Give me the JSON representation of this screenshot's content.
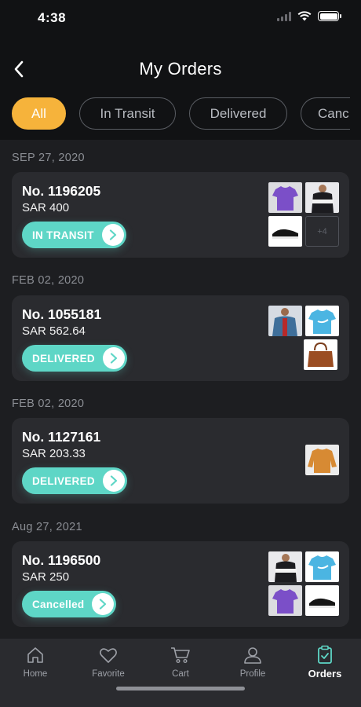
{
  "status_bar": {
    "time": "4:38"
  },
  "header": {
    "title": "My Orders"
  },
  "filters": [
    {
      "label": "All",
      "active": true
    },
    {
      "label": "In Transit",
      "active": false
    },
    {
      "label": "Delivered",
      "active": false
    },
    {
      "label": "Canc",
      "active": false
    }
  ],
  "orders": [
    {
      "date": "SEP 27, 2020",
      "number": "No. 1196205",
      "price": "SAR 400",
      "status": "IN TRANSIT",
      "more": "+4"
    },
    {
      "date": "FEB 02, 2020",
      "number": "No. 1055181",
      "price": "SAR 562.64",
      "status": "DELIVERED"
    },
    {
      "date": "FEB 02, 2020",
      "number": "No. 1127161",
      "price": "SAR 203.33",
      "status": "DELIVERED"
    },
    {
      "date": "Aug 27, 2021",
      "number": "No. 1196500",
      "price": "SAR 250",
      "status": "Cancelled"
    }
  ],
  "tabbar": [
    {
      "label": "Home",
      "icon": "home-icon"
    },
    {
      "label": "Favorite",
      "icon": "heart-icon"
    },
    {
      "label": "Cart",
      "icon": "cart-icon"
    },
    {
      "label": "Profile",
      "icon": "profile-icon"
    },
    {
      "label": "Orders",
      "icon": "orders-icon",
      "active": true
    }
  ],
  "colors": {
    "accent": "#f6b33b",
    "status": "#5ed6c6",
    "background": "#111214",
    "card": "#2a2b2f"
  }
}
